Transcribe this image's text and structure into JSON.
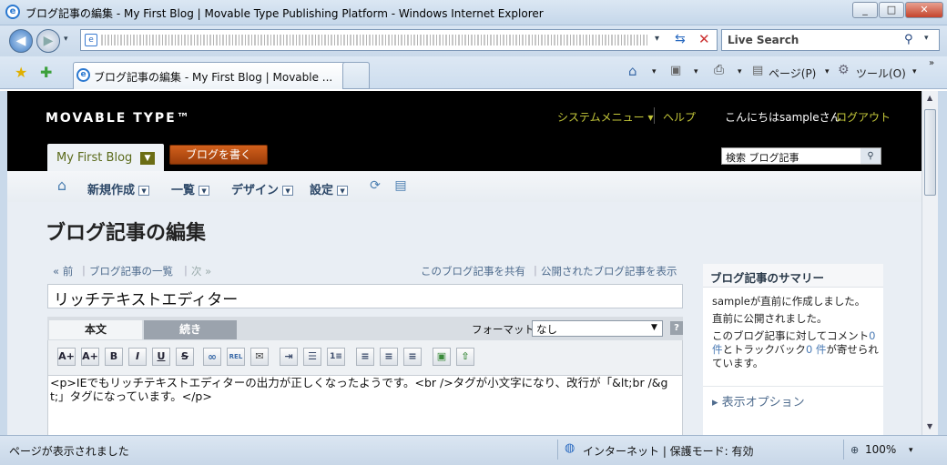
{
  "window": {
    "title": "ブログ記事の編集 - My First Blog | Movable Type Publishing Platform - Windows Internet Explorer",
    "min": "_",
    "max": "□",
    "close": "✕"
  },
  "addressbar": {
    "search_placeholder": "Live Search"
  },
  "tabs": {
    "active_title": "ブログ記事の編集 - My First Blog | Movable ...",
    "page_menu": "ページ(P)",
    "tools_menu": "ツール(O)"
  },
  "mt": {
    "logo": "MOVABLE TYPE™",
    "system_menu": "システムメニュー ▾",
    "help": "ヘルプ",
    "greeting": "こんにちはsampleさん",
    "logout": "ログアウト",
    "blog_name": "My First Blog",
    "write_button": "ブログを書く",
    "search_value": "検索 ブログ記事",
    "menu": {
      "new": "新規作成",
      "list": "一覧",
      "design": "デザイン",
      "settings": "設定"
    }
  },
  "page": {
    "title": "ブログ記事の編集",
    "prev": "« 前",
    "list": "ブログ記事の一覧",
    "next": "次 »",
    "share": "このブログ記事を共有",
    "view_published": "公開されたブログ記事を表示",
    "entry_title": "リッチテキストエディター"
  },
  "editor": {
    "tab_body": "本文",
    "tab_more": "続き",
    "format_label": "フォーマット:",
    "format_value": "なし",
    "help": "?",
    "content": "<p>IEでもリッチテキストエディターの出力が正しくなったようです。<br />タグが小文字になり、改行が「&lt;br /&gt;」タグになっています。</p>",
    "toolbar": [
      "A+",
      "A+",
      "B",
      "I",
      "U",
      "S",
      "link",
      "rel",
      "mail",
      "indent",
      "ul",
      "ol",
      "left",
      "center",
      "right",
      "img",
      "upload"
    ]
  },
  "sidebar": {
    "heading": "ブログ記事のサマリー",
    "line1": "sampleが直前に作成しました。",
    "line2": "直前に公開されました。",
    "line3a": "このブログ記事に対してコメント",
    "comments": "0 件",
    "line3b": "とトラックバック",
    "trackbacks": "0 件",
    "line3c": "が寄せられています。",
    "options": "▸ 表示オプション"
  },
  "status": {
    "left": "ページが表示されました",
    "zone": "インターネット | 保護モード: 有効",
    "zoom": "100%"
  }
}
